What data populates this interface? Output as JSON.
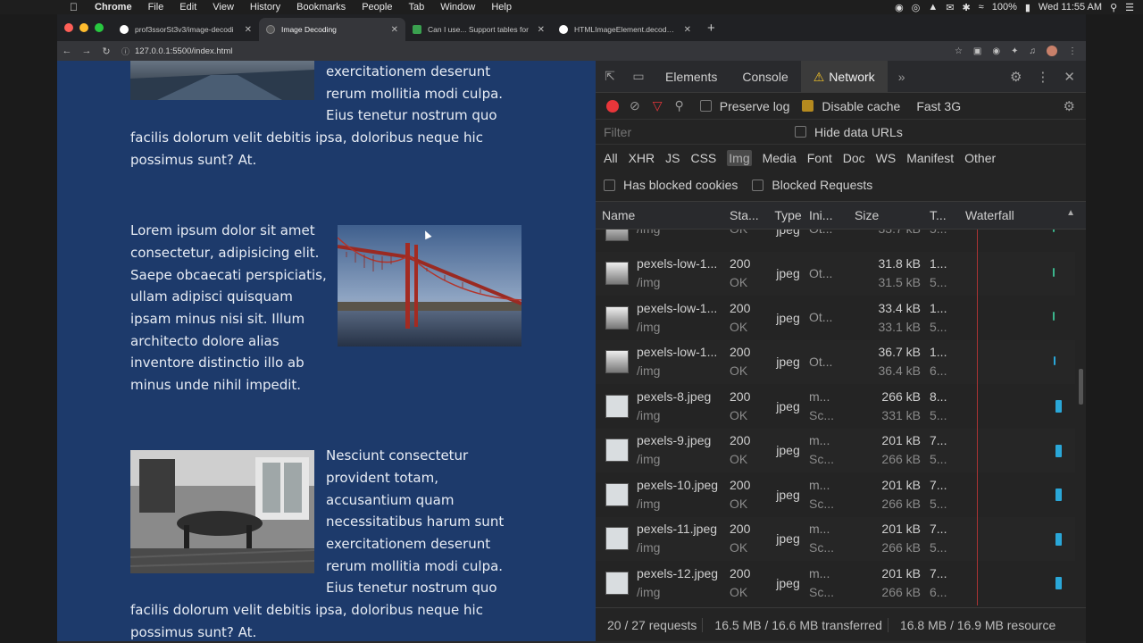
{
  "menubar": {
    "app_name": "Chrome",
    "items": [
      "File",
      "Edit",
      "View",
      "History",
      "Bookmarks",
      "People",
      "Tab",
      "Window",
      "Help"
    ],
    "battery": "100%",
    "clock": "Wed 11:55 AM"
  },
  "browser": {
    "tabs": [
      {
        "title": "prof3ssorSt3v3/image-decodi",
        "favicon": "github-icon",
        "color": "#ffffff"
      },
      {
        "title": "Image Decoding",
        "favicon": "globe-icon",
        "color": "#666666"
      },
      {
        "title": "Can I use... Support tables for",
        "favicon": "caniuse-icon",
        "color": "#3aa04f"
      },
      {
        "title": "HTMLImageElement.decode() -",
        "favicon": "mdn-icon",
        "color": "#ffffff"
      }
    ],
    "url": "127.0.0.1:5500/index.html"
  },
  "page": {
    "block1_lines": [
      "exercitationem deserunt",
      "rerum mollitia modi culpa.",
      "Eius tenetur nostrum quo"
    ],
    "block1_full": [
      "facilis dolorum velit debitis ipsa, doloribus neque hic",
      "possimus sunt? At."
    ],
    "block2_lines": [
      "Lorem ipsum dolor sit amet",
      "consectetur, adipisicing elit.",
      "Saepe obcaecati perspiciatis,",
      "ullam adipisci quisquam",
      "ipsam minus nisi sit. Illum",
      "architecto dolore alias",
      "inventore distinctio illo ab",
      "minus unde nihil impedit."
    ],
    "block3_lines": [
      "Nesciunt consectetur",
      "provident totam,",
      "accusantium quam",
      "necessitatibus harum sunt",
      "exercitationem deserunt",
      "rerum mollitia modi culpa.",
      "Eius tenetur nostrum quo"
    ],
    "block3_full": [
      "facilis dolorum velit debitis ipsa, doloribus neque hic",
      "possimus sunt? At."
    ]
  },
  "devtools": {
    "tabs": [
      "Elements",
      "Console",
      "Network"
    ],
    "active_tab": "Network",
    "preserve_log": "Preserve log",
    "disable_cache": "Disable cache",
    "throttle": "Fast 3G",
    "filter_placeholder": "Filter",
    "hide_data_urls": "Hide data URLs",
    "types": [
      "All",
      "XHR",
      "JS",
      "CSS",
      "Img",
      "Media",
      "Font",
      "Doc",
      "WS",
      "Manifest",
      "Other"
    ],
    "active_type": "Img",
    "has_blocked_cookies": "Has blocked cookies",
    "blocked_requests": "Blocked Requests",
    "columns": [
      "Name",
      "Sta...",
      "Type",
      "Ini...",
      "Size",
      "T...",
      "Waterfall"
    ],
    "rows": [
      {
        "name": "",
        "path": "/img",
        "status": "",
        "status_text": "OK",
        "type": "jpeg",
        "init": "Ot...",
        "init2": "",
        "size": "",
        "size2": "33.7 kB",
        "time": "",
        "time2": "5...",
        "thumb": "bw"
      },
      {
        "name": "pexels-low-1...",
        "path": "/img",
        "status": "200",
        "status_text": "OK",
        "type": "jpeg",
        "init": "Ot...",
        "init2": "",
        "size": "31.8 kB",
        "size2": "31.5 kB",
        "time": "1...",
        "time2": "5...",
        "thumb": "bw"
      },
      {
        "name": "pexels-low-1...",
        "path": "/img",
        "status": "200",
        "status_text": "OK",
        "type": "jpeg",
        "init": "Ot...",
        "init2": "",
        "size": "33.4 kB",
        "size2": "33.1 kB",
        "time": "1...",
        "time2": "5...",
        "thumb": "bw"
      },
      {
        "name": "pexels-low-1...",
        "path": "/img",
        "status": "200",
        "status_text": "OK",
        "type": "jpeg",
        "init": "Ot...",
        "init2": "",
        "size": "36.7 kB",
        "size2": "36.4 kB",
        "time": "1...",
        "time2": "6...",
        "thumb": "bw"
      },
      {
        "name": "pexels-8.jpeg",
        "path": "/img",
        "status": "200",
        "status_text": "OK",
        "type": "jpeg",
        "init": "m...",
        "init2": "Sc...",
        "size": "266 kB",
        "size2": "331 kB",
        "time": "8...",
        "time2": "5...",
        "thumb": "broken"
      },
      {
        "name": "pexels-9.jpeg",
        "path": "/img",
        "status": "200",
        "status_text": "OK",
        "type": "jpeg",
        "init": "m...",
        "init2": "Sc...",
        "size": "201 kB",
        "size2": "266 kB",
        "time": "7...",
        "time2": "5...",
        "thumb": "broken"
      },
      {
        "name": "pexels-10.jpeg",
        "path": "/img",
        "status": "200",
        "status_text": "OK",
        "type": "jpeg",
        "init": "m...",
        "init2": "Sc...",
        "size": "201 kB",
        "size2": "266 kB",
        "time": "7...",
        "time2": "5...",
        "thumb": "broken"
      },
      {
        "name": "pexels-11.jpeg",
        "path": "/img",
        "status": "200",
        "status_text": "OK",
        "type": "jpeg",
        "init": "m...",
        "init2": "Sc...",
        "size": "201 kB",
        "size2": "266 kB",
        "time": "7...",
        "time2": "5...",
        "thumb": "broken"
      },
      {
        "name": "pexels-12.jpeg",
        "path": "/img",
        "status": "200",
        "status_text": "OK",
        "type": "jpeg",
        "init": "m...",
        "init2": "Sc...",
        "size": "201 kB",
        "size2": "266 kB",
        "time": "7...",
        "time2": "6...",
        "thumb": "broken"
      }
    ],
    "status_bar": [
      "20 / 27 requests",
      "16.5 MB / 16.6 MB transferred",
      "16.8 MB / 16.9 MB resource"
    ]
  },
  "colors": {
    "page_bg": "#1d3a6b",
    "devtools_bg": "#242424",
    "record": "#e8363a",
    "waterfall": "#2aa7d8"
  }
}
